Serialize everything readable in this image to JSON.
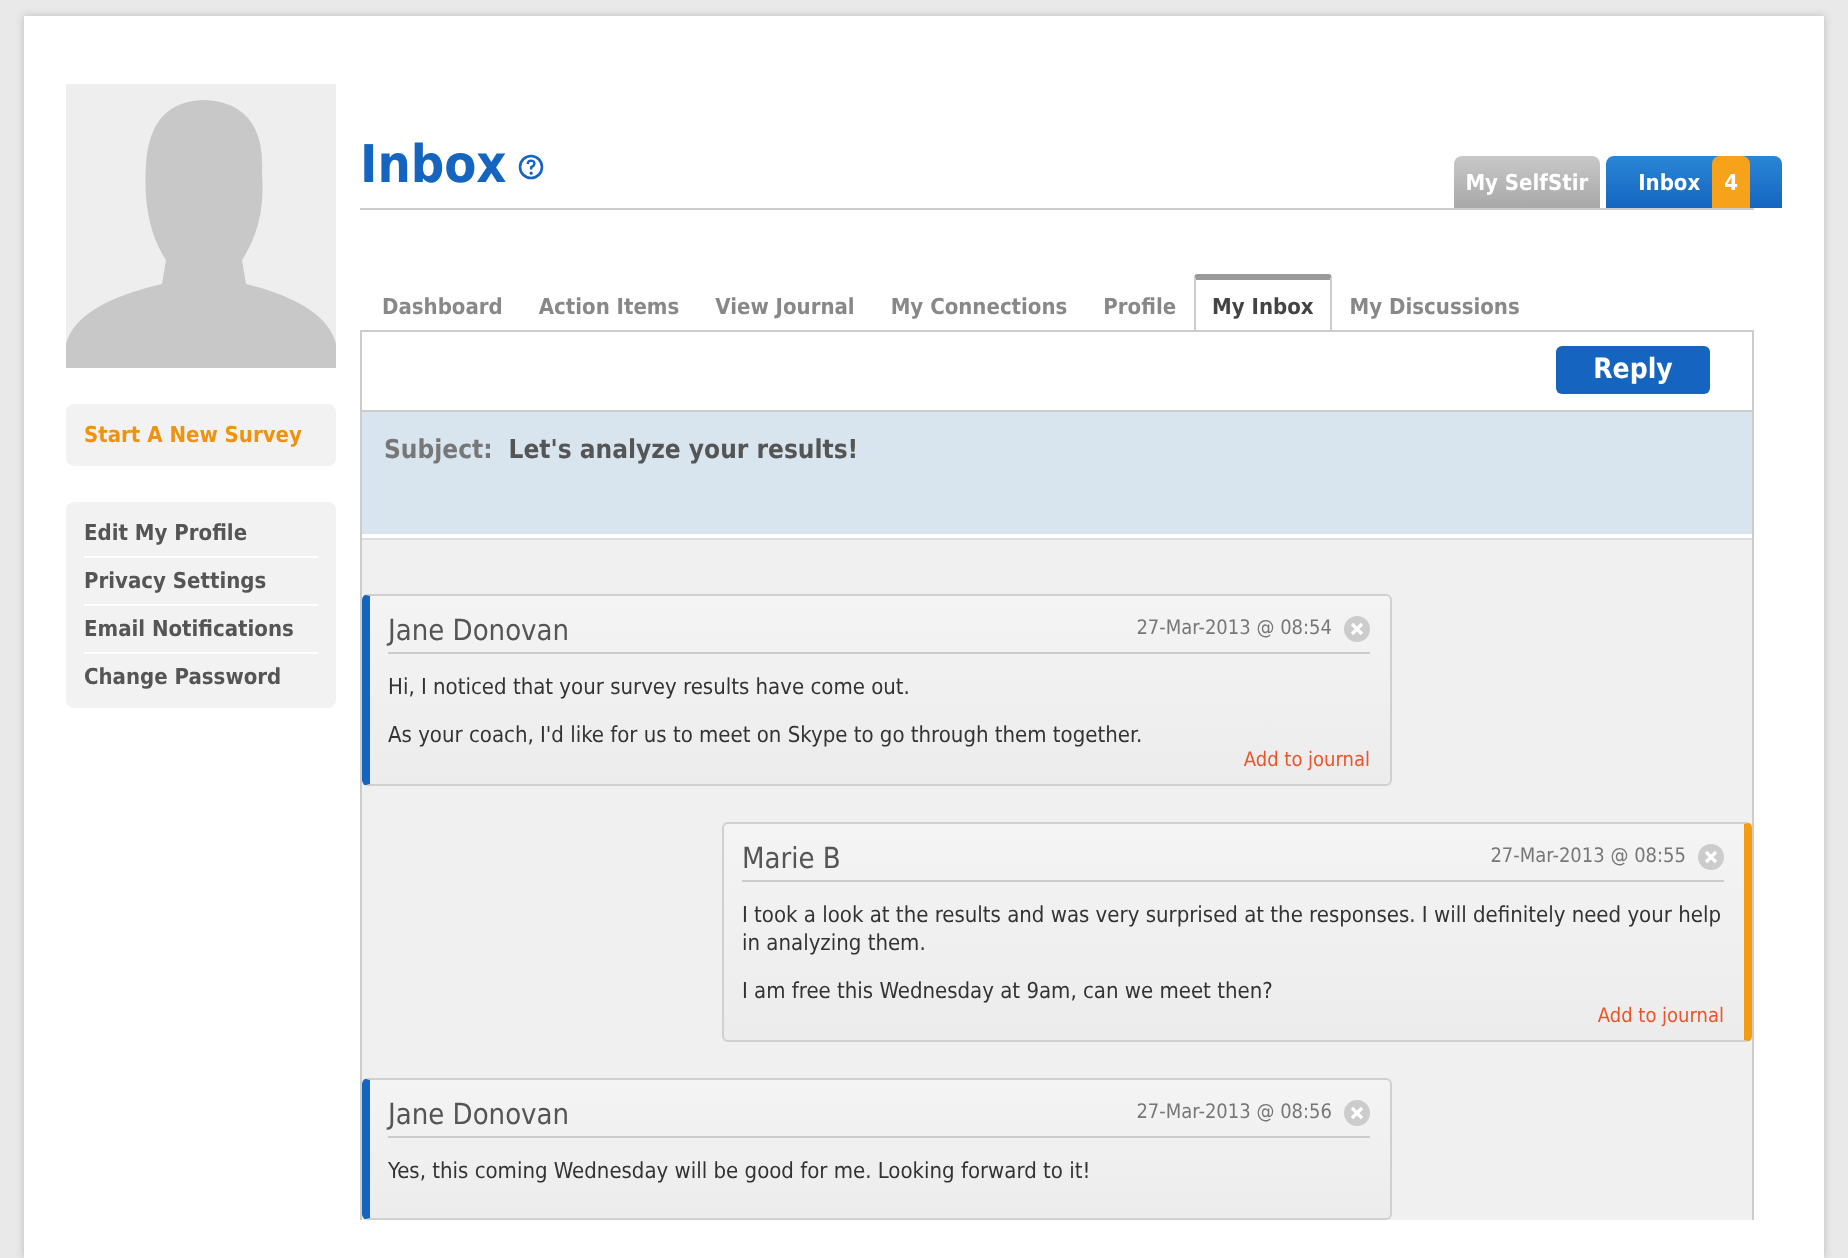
{
  "sidebar": {
    "action": "Start A New Survey",
    "links": [
      "Edit My Profile",
      "Privacy Settings",
      "Email Notifications",
      "Change Password"
    ]
  },
  "header": {
    "title": "Inbox",
    "top_tabs": [
      {
        "label": "My SelfStir",
        "selected": false
      },
      {
        "label": "Inbox",
        "selected": true,
        "badge": "4"
      }
    ]
  },
  "tabs": [
    {
      "label": "Dashboard",
      "selected": false
    },
    {
      "label": "Action Items",
      "selected": false
    },
    {
      "label": "View Journal",
      "selected": false
    },
    {
      "label": "My Connections",
      "selected": false
    },
    {
      "label": "Profile",
      "selected": false
    },
    {
      "label": "My Inbox",
      "selected": true
    },
    {
      "label": "My Discussions",
      "selected": false
    }
  ],
  "reply_button": "Reply",
  "subject": {
    "label": "Subject:",
    "text": "Let's analyze your results!"
  },
  "messages": [
    {
      "kind": "left",
      "author": "Jane Donovan",
      "time": "27-Mar-2013 @ 08:54",
      "paragraphs": [
        "Hi, I noticed that your survey results have come out.",
        "As your coach, I'd like for us to meet on Skype to go through them together."
      ],
      "journal_link": "Add to journal"
    },
    {
      "kind": "right",
      "author": "Marie B",
      "time": "27-Mar-2013 @ 08:55",
      "paragraphs": [
        "I took a look at the results and was very surprised at the responses. I will definitely need your help in analyzing them.",
        "I am free this Wednesday at 9am, can we meet then?"
      ],
      "journal_link": "Add to journal"
    },
    {
      "kind": "left",
      "author": "Jane Donovan",
      "time": "27-Mar-2013 @ 08:56",
      "paragraphs": [
        "Yes, this coming Wednesday will be good for me. Looking forward to it!"
      ]
    }
  ]
}
